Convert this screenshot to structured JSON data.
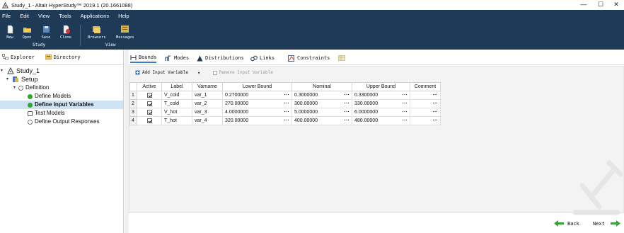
{
  "window": {
    "title": "Study_1 - Altair HyperStudy™ 2019.1 (20.1661088)",
    "minimize": "—",
    "maximize": "☐",
    "close": "✕"
  },
  "menu": [
    "File",
    "Edit",
    "View",
    "Tools",
    "Applications",
    "Help"
  ],
  "toolbar": {
    "buttons": [
      {
        "label": "New",
        "icon": "new-file-icon"
      },
      {
        "label": "Open",
        "icon": "open-folder-icon"
      },
      {
        "label": "Save",
        "icon": "save-icon"
      },
      {
        "label": "Close",
        "icon": "close-file-icon"
      },
      {
        "label": "Browsers",
        "icon": "browsers-icon"
      },
      {
        "label": "Messages",
        "icon": "messages-icon"
      }
    ],
    "groups": {
      "study": "Study",
      "view": "View"
    }
  },
  "left_tabs": {
    "explorer": "Explorer",
    "directory": "Directory"
  },
  "tree": {
    "study": "Study_1",
    "setup": "Setup",
    "definition": "Definition",
    "define_models": "Define Models",
    "define_input_variables": "Define Input Variables",
    "test_models": "Test Models",
    "define_output_responses": "Define Output Responses"
  },
  "right_tabs": {
    "bounds": "Bounds",
    "modes": "Modes",
    "distributions": "Distributions",
    "links": "Links",
    "constraints": "Constraints"
  },
  "actions": {
    "add": "Add Input Variable",
    "remove": "Remove Input Variable"
  },
  "table": {
    "columns": [
      "Active",
      "Label",
      "Varname",
      "Lower Bound",
      "Nominal",
      "Upper Bound",
      "Comment"
    ],
    "rows": [
      {
        "n": "1",
        "label": "V_cold",
        "varname": "var_1",
        "lower": "0.2700000",
        "nominal": "0.3000000",
        "upper": "0.3300000"
      },
      {
        "n": "2",
        "label": "T_cold",
        "varname": "var_2",
        "lower": "270.00000",
        "nominal": "300.00000",
        "upper": "330.00000"
      },
      {
        "n": "3",
        "label": "V_hot",
        "varname": "var_3",
        "lower": "4.0000000",
        "nominal": "5.0000000",
        "upper": "6.0000000"
      },
      {
        "n": "4",
        "label": "T_hot",
        "varname": "var_4",
        "lower": "320.00000",
        "nominal": "400.00000",
        "upper": "480.00000"
      }
    ],
    "ellipsis": "..."
  },
  "nav": {
    "back": "Back",
    "next": "Next"
  },
  "colors": {
    "chrome": "#1f3a57",
    "accent": "#2ca82c",
    "selection": "#cfe3f7"
  }
}
